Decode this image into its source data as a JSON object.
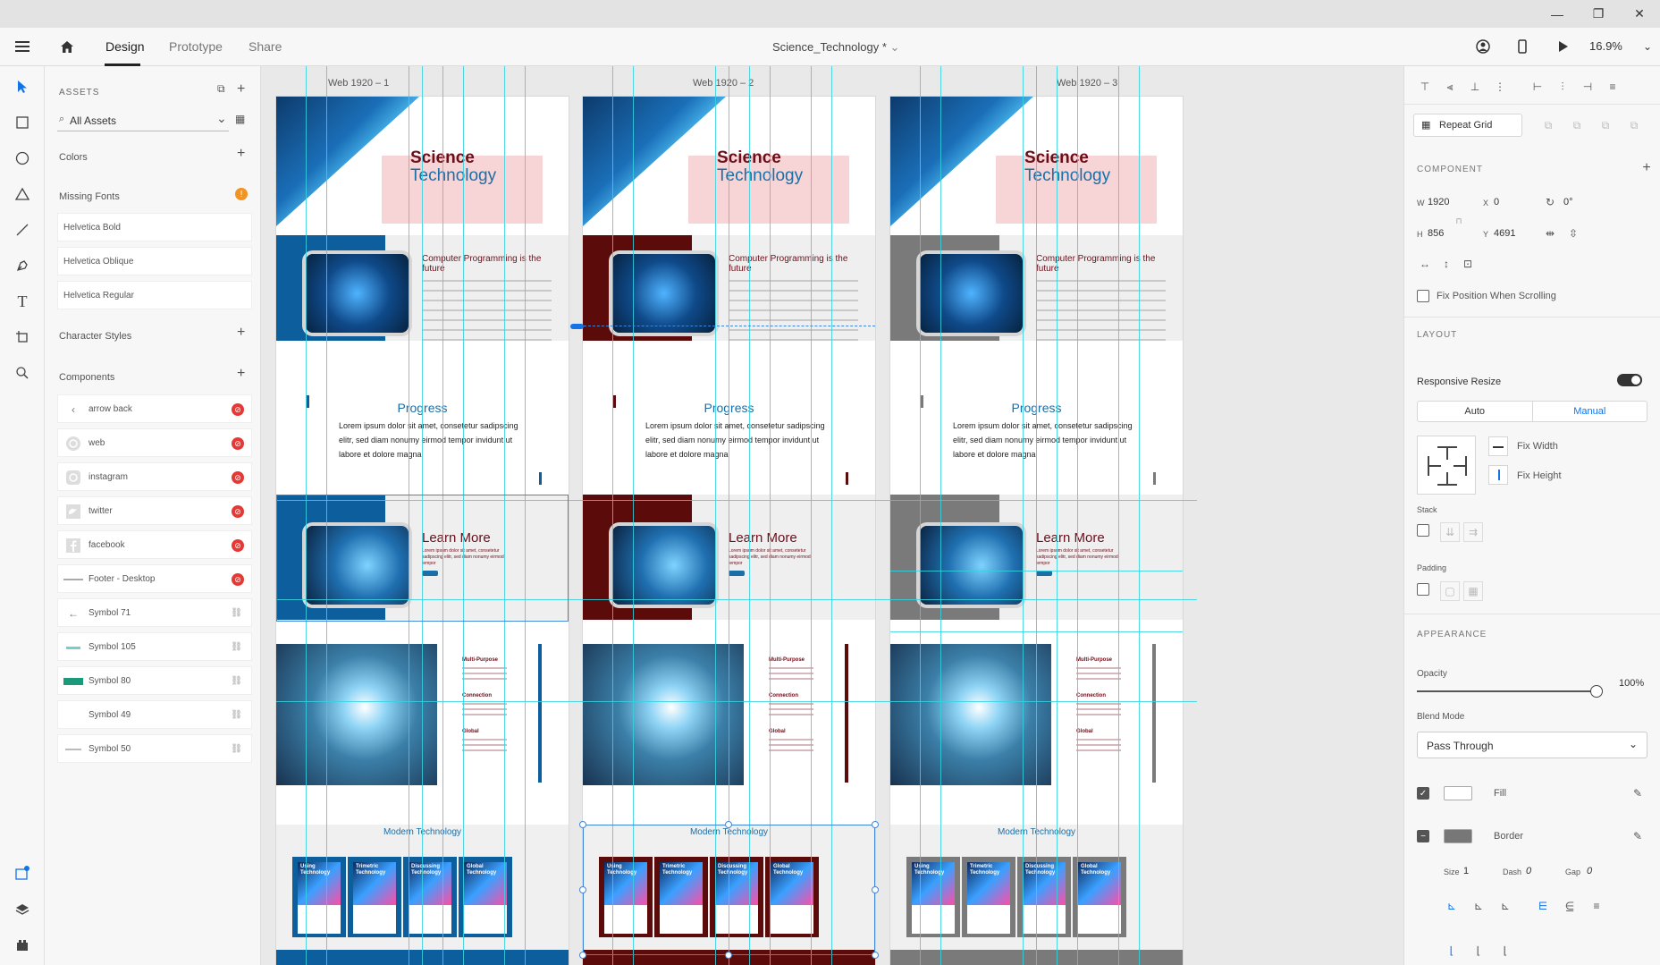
{
  "window": {
    "minimize_icon": "minimize-icon",
    "restore_icon": "restore-icon",
    "close_icon": "close-icon"
  },
  "menubar": {
    "tabs": [
      {
        "label": "Design",
        "active": true
      },
      {
        "label": "Prototype",
        "active": false
      },
      {
        "label": "Share",
        "active": false
      }
    ],
    "document_title": "Science_Technology *",
    "zoom": "16.9%"
  },
  "assets": {
    "heading": "ASSETS",
    "filter": "All Assets",
    "colors_label": "Colors",
    "missing_fonts_label": "Missing Fonts",
    "missing_fonts": [
      "Helvetica Bold",
      "Helvetica Oblique",
      "Helvetica Regular"
    ],
    "character_styles_label": "Character Styles",
    "components_label": "Components",
    "components": [
      {
        "name": "arrow back",
        "badge": "broken"
      },
      {
        "name": "web",
        "badge": "broken"
      },
      {
        "name": "instagram",
        "badge": "broken"
      },
      {
        "name": "twitter",
        "badge": "broken"
      },
      {
        "name": "facebook",
        "badge": "broken"
      },
      {
        "name": "Footer - Desktop",
        "badge": "broken"
      },
      {
        "name": "Symbol 71",
        "badge": "link"
      },
      {
        "name": "Symbol 105",
        "badge": "link"
      },
      {
        "name": "Symbol 80",
        "badge": "link"
      },
      {
        "name": "Symbol 49",
        "badge": "link"
      },
      {
        "name": "Symbol 50",
        "badge": "link"
      }
    ]
  },
  "artboards": [
    {
      "label": "Web 1920 – 1",
      "accent": "#0d5e9c"
    },
    {
      "label": "Web 1920 – 2",
      "accent": "#5c0b0b"
    },
    {
      "label": "Web 1920 – 3",
      "accent": "#7a7a7a"
    }
  ],
  "artboard_content": {
    "hero_title_1": "Science",
    "hero_title_2": "Technology",
    "card_title": "Computer Programming is the future",
    "progress_title": "Progress",
    "progress_text": "Lorem ipsum dolor sit amet, consetetur sadipscing elitr, sed diam nonumy eirmod tempor invidunt ut labore et dolore magna",
    "learn_title": "Learn More",
    "learn_text": "Lorem ipsum dolor sit amet, consetetur sadipscing elitr, sed diam nonumy eirmod tempor",
    "mp_titles": [
      "Multi-Purpose",
      "Connection",
      "Global"
    ],
    "modern_title": "Modern Technology",
    "modern_cards": [
      "Using Technology",
      "Trimetric Technology",
      "Discussing Technology",
      "Global Technology"
    ]
  },
  "properties": {
    "repeat_grid": "Repeat Grid",
    "component_heading": "COMPONENT",
    "w_label": "W",
    "w_value": "1920",
    "x_label": "X",
    "x_value": "0",
    "h_label": "H",
    "h_value": "856",
    "y_label": "Y",
    "y_value": "4691",
    "rotation": "0°",
    "fix_position": "Fix Position When Scrolling",
    "layout_heading": "LAYOUT",
    "responsive_resize": "Responsive Resize",
    "auto": "Auto",
    "manual": "Manual",
    "fix_width": "Fix Width",
    "fix_height": "Fix Height",
    "stack": "Stack",
    "padding": "Padding",
    "appearance_heading": "APPEARANCE",
    "opacity_label": "Opacity",
    "opacity_value": "100%",
    "blend_mode_label": "Blend Mode",
    "blend_mode_value": "Pass Through",
    "fill_label": "Fill",
    "border_label": "Border",
    "size_label": "Size",
    "size_value": "1",
    "dash_label": "Dash",
    "dash_value": "0",
    "gap_label": "Gap",
    "gap_value": "0"
  }
}
